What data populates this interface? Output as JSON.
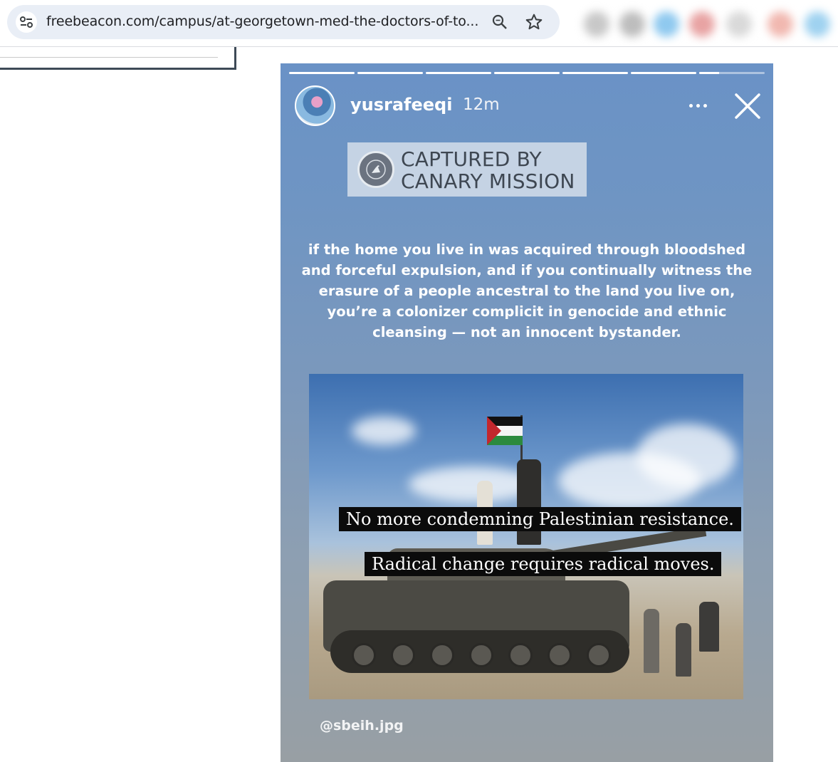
{
  "browser": {
    "url": "freebeacon.com/campus/at-georgetown-med-the-doctors-of-to...",
    "icons": [
      "site-info-icon",
      "search-icon",
      "star-icon"
    ]
  },
  "story": {
    "username": "yusrafeeqi",
    "time": "12m",
    "progress": [
      1,
      1,
      1,
      1,
      1,
      1,
      0.3
    ],
    "watermark": {
      "line1": "CAPTURED BY",
      "line2": "CANARY MISSION"
    },
    "quote": "if the home you live in was acquired through bloodshed and forceful expulsion, and if you continually witness the erasure of a people ancestral to the land you live on, you’re a colonizer complicit in genocide and ethnic cleansing — not an innocent bystander.",
    "photo": {
      "caption1": "No more condemning Palestinian resistance.",
      "caption2": "Radical change requires radical moves."
    },
    "credit": "@sbeih.jpg"
  },
  "colors": {
    "story_top": "#6a92c6",
    "story_bottom": "#989fa4",
    "watermark_bg": "#c5d3e4"
  }
}
